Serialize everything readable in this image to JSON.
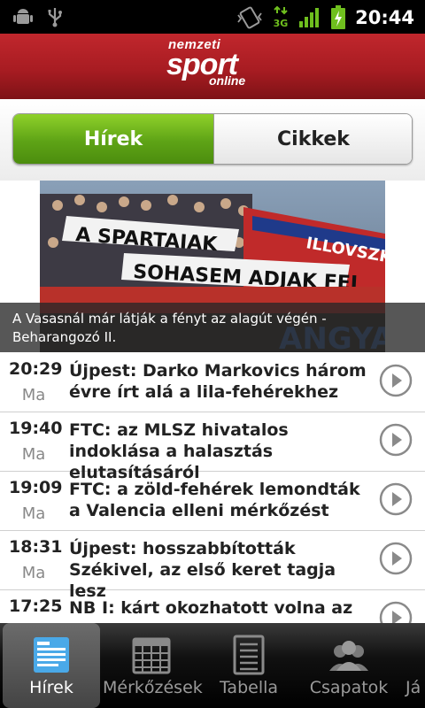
{
  "status_bar": {
    "time": "20:44",
    "network": "3G"
  },
  "header": {
    "logo_line1": "nemzeti",
    "logo_line2": "sport",
    "logo_line3": "online"
  },
  "tabs": [
    {
      "label": "Hírek",
      "active": true
    },
    {
      "label": "Cikkek",
      "active": false
    }
  ],
  "featured": {
    "caption": "A Vasasnál már látják a fényt az alagút végén - Beharangozó II."
  },
  "news": [
    {
      "time": "20:29",
      "day": "Ma",
      "title": "Újpest: Darko Markovics három évre írt alá a lila-fehérekhez"
    },
    {
      "time": "19:40",
      "day": "Ma",
      "title": "FTC: az MLSZ hivatalos indoklása a halasztás elutasításáról"
    },
    {
      "time": "19:09",
      "day": "Ma",
      "title": "FTC: a zöld-fehérek lemondták a Valencia elleni mérkőzést"
    },
    {
      "time": "18:31",
      "day": "Ma",
      "title": "Újpest: hosszabbították Székivel, az első keret tagja lesz"
    },
    {
      "time": "17:25",
      "day": "",
      "title": "NB I: kárt okozhatott volna az"
    }
  ],
  "bottom_nav": [
    {
      "label": "Hírek",
      "icon": "news-icon",
      "active": true
    },
    {
      "label": "Mérkőzések",
      "icon": "calendar-icon",
      "active": false
    },
    {
      "label": "Tabella",
      "icon": "table-icon",
      "active": false
    },
    {
      "label": "Csapatok",
      "icon": "teams-icon",
      "active": false
    },
    {
      "label": "Já",
      "icon": "players-icon",
      "active": false
    }
  ],
  "colors": {
    "header_red": "#b3222a",
    "active_green": "#5ea316",
    "nav_bg": "#111111"
  }
}
